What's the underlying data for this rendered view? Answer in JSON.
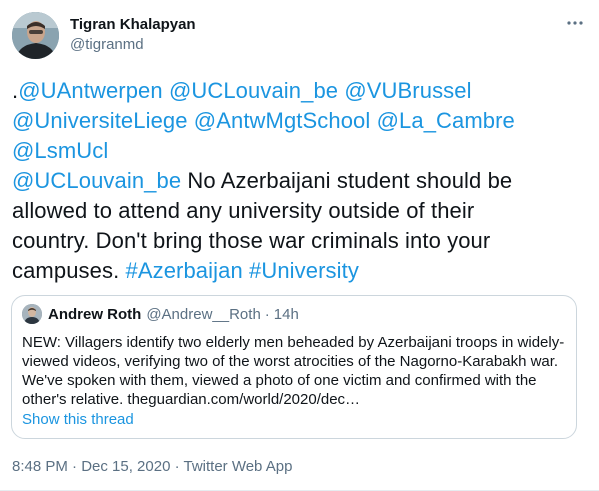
{
  "author": {
    "name": "Tigran Khalapyan",
    "handle": "@tigranmd"
  },
  "tweet": {
    "lines": [
      [
        {
          "text": ".",
          "link": false
        },
        {
          "text": "@UAntwerpen",
          "link": true
        },
        {
          "text": " ",
          "link": false
        },
        {
          "text": "@UCLouvain_be",
          "link": true
        },
        {
          "text": " ",
          "link": false
        },
        {
          "text": "@VUBrussel",
          "link": true
        }
      ],
      [
        {
          "text": "@UniversiteLiege",
          "link": true
        },
        {
          "text": " ",
          "link": false
        },
        {
          "text": "@AntwMgtSchool",
          "link": true
        },
        {
          "text": " ",
          "link": false
        },
        {
          "text": "@La_Cambre",
          "link": true
        }
      ],
      [
        {
          "text": "@LsmUcl",
          "link": true
        }
      ],
      [
        {
          "text": "@UCLouvain_be",
          "link": true
        },
        {
          "text": " No Azerbaijani student should be",
          "link": false
        }
      ],
      [
        {
          "text": "allowed to attend any university outside of their",
          "link": false
        }
      ],
      [
        {
          "text": "country. Don't bring those war criminals into your",
          "link": false
        }
      ],
      [
        {
          "text": "campuses. ",
          "link": false
        },
        {
          "text": "#Azerbaijan",
          "link": true
        },
        {
          "text": " ",
          "link": false
        },
        {
          "text": "#University",
          "link": true
        }
      ]
    ]
  },
  "quote": {
    "name": "Andrew Roth",
    "handle": "@Andrew__Roth",
    "separator": "·",
    "time": "14h",
    "lines": [
      "NEW: Villagers identify two elderly men beheaded by Azerbaijani troops in widely-",
      "viewed videos, verifying two of the worst atrocities of the Nagorno-Karabakh war.",
      "We've spoken with them, viewed a photo of one victim and confirmed with the",
      "other's relative. theguardian.com/world/2020/dec…"
    ],
    "show_thread": "Show this thread"
  },
  "footer": {
    "timestamp": "8:48 PM · Dec 15, 2020 · Twitter Web App"
  },
  "colors": {
    "link": "#1b95e0",
    "text": "#0f1419",
    "muted": "#5b7083",
    "border": "#ccd6dd"
  },
  "icons": {
    "more": "more-options-icon"
  }
}
